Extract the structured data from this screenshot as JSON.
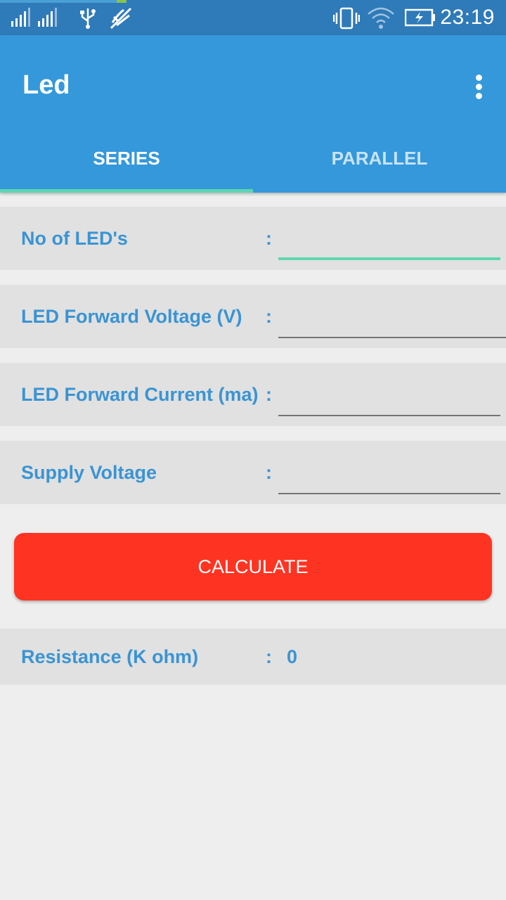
{
  "status_bar": {
    "time": "23:19",
    "icons": [
      "signal-icon",
      "signal-icon",
      "usb-icon",
      "mic-off-icon",
      "vibrate-icon",
      "wifi-icon",
      "battery-charging-icon"
    ]
  },
  "app_bar": {
    "title": "Led",
    "overflow_icon": "more-vert-icon"
  },
  "tabs": [
    {
      "label": "SERIES",
      "selected": true
    },
    {
      "label": "PARALLEL",
      "selected": false
    }
  ],
  "form": {
    "fields": [
      {
        "label": "No of LED's",
        "colon": ":",
        "value": ""
      },
      {
        "label": "LED Forward Voltage (V)",
        "colon": ":",
        "value": ""
      },
      {
        "label": "LED Forward Current (ma)",
        "colon": ":",
        "value": ""
      },
      {
        "label": "Supply Voltage",
        "colon": ":",
        "value": ""
      }
    ],
    "calculate_label": "CALCULATE"
  },
  "result": {
    "label": "Resistance  (K ohm)",
    "colon": ":",
    "value": "0"
  },
  "colors": {
    "status_bar": "#2f7ab8",
    "app_bar": "#3498db",
    "accent": "#5fd6b0",
    "label_text": "#3a94d3",
    "button": "#ff3322",
    "background": "#eeeeee",
    "row_background": "#e1e1e1"
  }
}
